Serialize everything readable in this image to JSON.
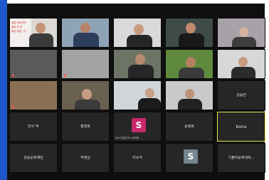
{
  "participants": [
    {
      "name": "",
      "kind": "video",
      "poster_lines": [
        "갈등 어르신의",
        "삶의 의 조",
        "확산 방법 · 다"
      ]
    },
    {
      "name": "",
      "kind": "video"
    },
    {
      "name": "",
      "kind": "video"
    },
    {
      "name": "",
      "kind": "video"
    },
    {
      "name": "",
      "kind": "video"
    },
    {
      "name": "",
      "kind": "video"
    },
    {
      "name": "",
      "kind": "video"
    },
    {
      "name": "",
      "kind": "video"
    },
    {
      "name": "",
      "kind": "video"
    },
    {
      "name": "",
      "kind": "video"
    },
    {
      "name": "",
      "kind": "video"
    },
    {
      "name": "",
      "kind": "video"
    },
    {
      "name": "",
      "kind": "video"
    },
    {
      "name": "",
      "kind": "video"
    },
    {
      "name": "김동진",
      "kind": "name"
    },
    {
      "name": "민우 박",
      "kind": "name"
    },
    {
      "name": "황정호",
      "kind": "name"
    },
    {
      "name": "",
      "kind": "avatar",
      "initial": "S",
      "color": "#c7286a",
      "subname": "강소기업연구소 효과회"
    },
    {
      "name": "윤정호",
      "kind": "name"
    },
    {
      "name": "bonu",
      "kind": "name",
      "active": true
    },
    {
      "name": "강증문화재단",
      "kind": "name"
    },
    {
      "name": "주영균",
      "kind": "name"
    },
    {
      "name": "이유석",
      "kind": "name"
    },
    {
      "name": "",
      "kind": "avatar",
      "initial": "S",
      "color": "#74858f"
    },
    {
      "name": "기불락문화대회...",
      "kind": "name"
    }
  ]
}
